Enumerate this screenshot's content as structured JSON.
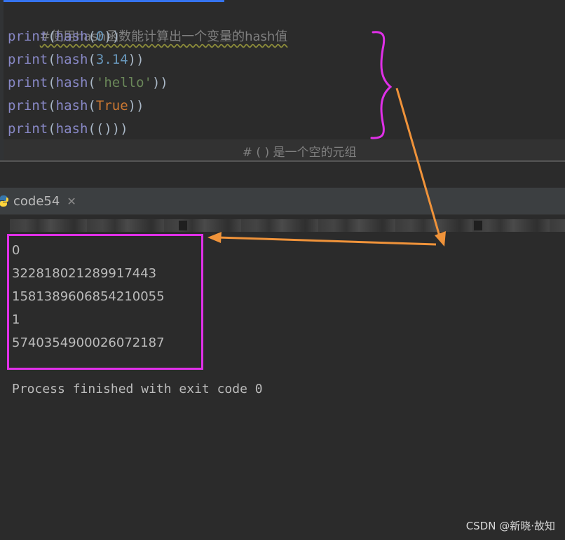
{
  "editor": {
    "comment": "#使用hash函数能计算出一个变量的hash值",
    "lines": [
      {
        "fn": "print",
        "open": "(",
        "inner_fn": "hash",
        "inner_open": "(",
        "arg": "0",
        "close": "))"
      },
      {
        "fn": "print",
        "open": "(",
        "inner_fn": "hash",
        "inner_open": "(",
        "arg": "3.14",
        "close": "))"
      },
      {
        "fn": "print",
        "open": "(",
        "inner_fn": "hash",
        "inner_open": "(",
        "arg": "'hello'",
        "close": "))"
      },
      {
        "fn": "print",
        "open": "(",
        "inner_fn": "hash",
        "inner_open": "(",
        "arg": "True",
        "close": "))"
      },
      {
        "fn": "print",
        "open": "(",
        "inner_fn": "hash",
        "inner_open": "(",
        "arg": "()",
        "close": "))"
      }
    ],
    "inline_comment": "# ( ) 是一个空的元组"
  },
  "run_panel": {
    "tab_label": "code54",
    "close_glyph": "✕",
    "output": [
      "0",
      "3228180212899174​43",
      "1581389606854210055",
      "1",
      "5740354900026072187"
    ],
    "process_line": "Process finished with exit code 0"
  },
  "annotations": {
    "brace_color": "#e030e8",
    "arrow_color": "#f0933a",
    "box_color": "#e030e8"
  },
  "watermark": "CSDN @新晓·故知"
}
